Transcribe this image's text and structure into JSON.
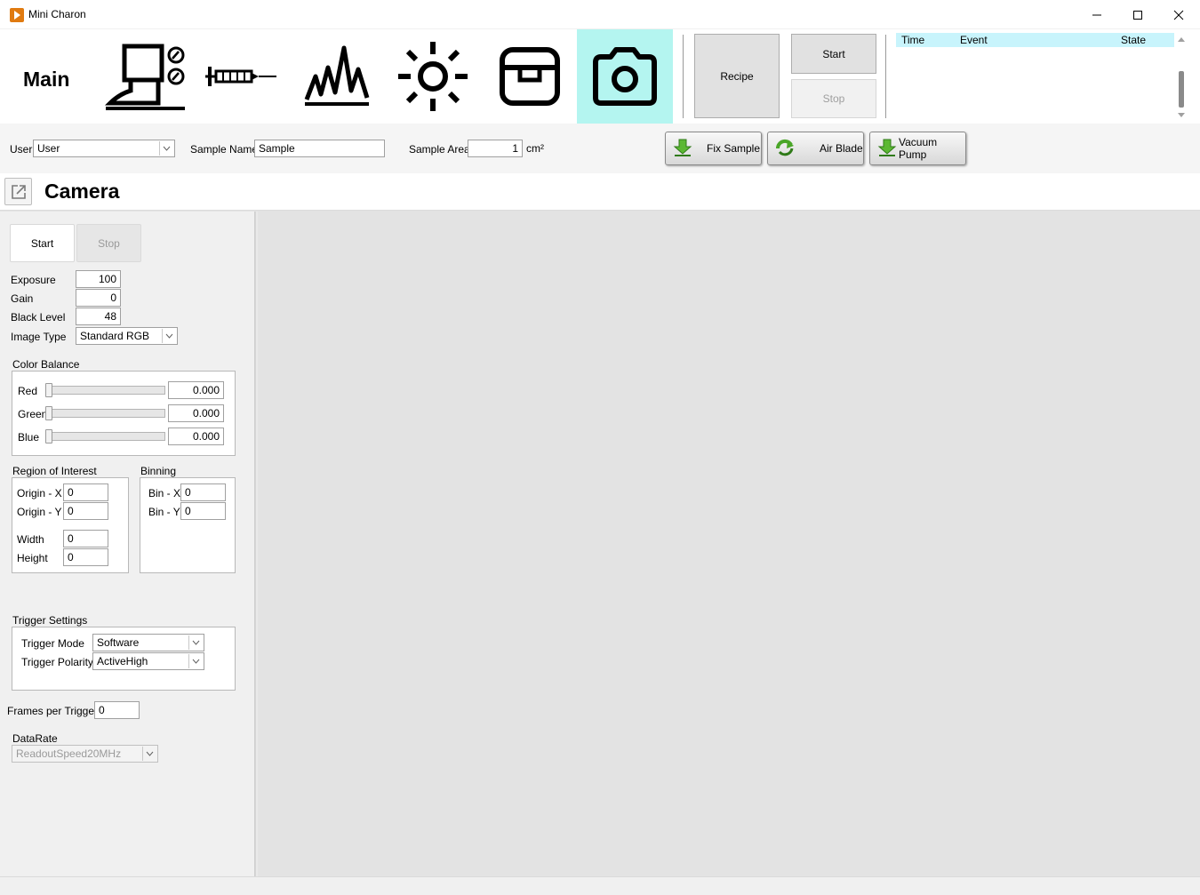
{
  "window": {
    "title": "Mini Charon"
  },
  "toolbar": {
    "main_label": "Main",
    "recipe_label": "Recipe",
    "start_label": "Start",
    "stop_label": "Stop",
    "active_color": "#b4f5f0"
  },
  "event_log": {
    "columns": [
      "Time",
      "Event",
      "State"
    ]
  },
  "sample": {
    "user_label": "User",
    "user_value": "User",
    "name_label": "Sample Name",
    "name_value": "Sample",
    "area_label": "Sample Area",
    "area_value": "1",
    "area_unit": "cm²",
    "fix_label": "Fix Sample",
    "air_label": "Air Blade",
    "vacuum_label": "Vacuum Pump"
  },
  "page": {
    "title": "Camera"
  },
  "camera": {
    "start_label": "Start",
    "stop_label": "Stop",
    "exposure_label": "Exposure",
    "exposure_value": "100",
    "gain_label": "Gain",
    "gain_value": "0",
    "black_label": "Black Level",
    "black_value": "48",
    "imagetype_label": "Image Type",
    "imagetype_value": "Standard RGB",
    "colorbalance_label": "Color Balance",
    "red_label": "Red",
    "red_value": "0.000",
    "red_level": 0,
    "green_label": "Green",
    "green_value": "0.000",
    "green_level": 0,
    "blue_label": "Blue",
    "blue_value": "0.000",
    "blue_level": 0,
    "roi_label": "Region of Interest",
    "originx_label": "Origin - X",
    "originx_value": "0",
    "originy_label": "Origin - Y",
    "originy_value": "0",
    "width_label": "Width",
    "width_value": "0",
    "height_label": "Height",
    "height_value": "0",
    "binning_label": "Binning",
    "binx_label": "Bin - X",
    "binx_value": "0",
    "biny_label": "Bin - Y",
    "biny_value": "0",
    "trigger_label": "Trigger Settings",
    "triggermode_label": "Trigger Mode",
    "triggermode_value": "Software",
    "triggerpol_label": "Trigger Polarity",
    "triggerpol_value": "ActiveHigh",
    "frames_label": "Frames per Trigger",
    "frames_value": "0",
    "datarate_label": "DataRate",
    "datarate_value": "ReadoutSpeed20MHz"
  }
}
